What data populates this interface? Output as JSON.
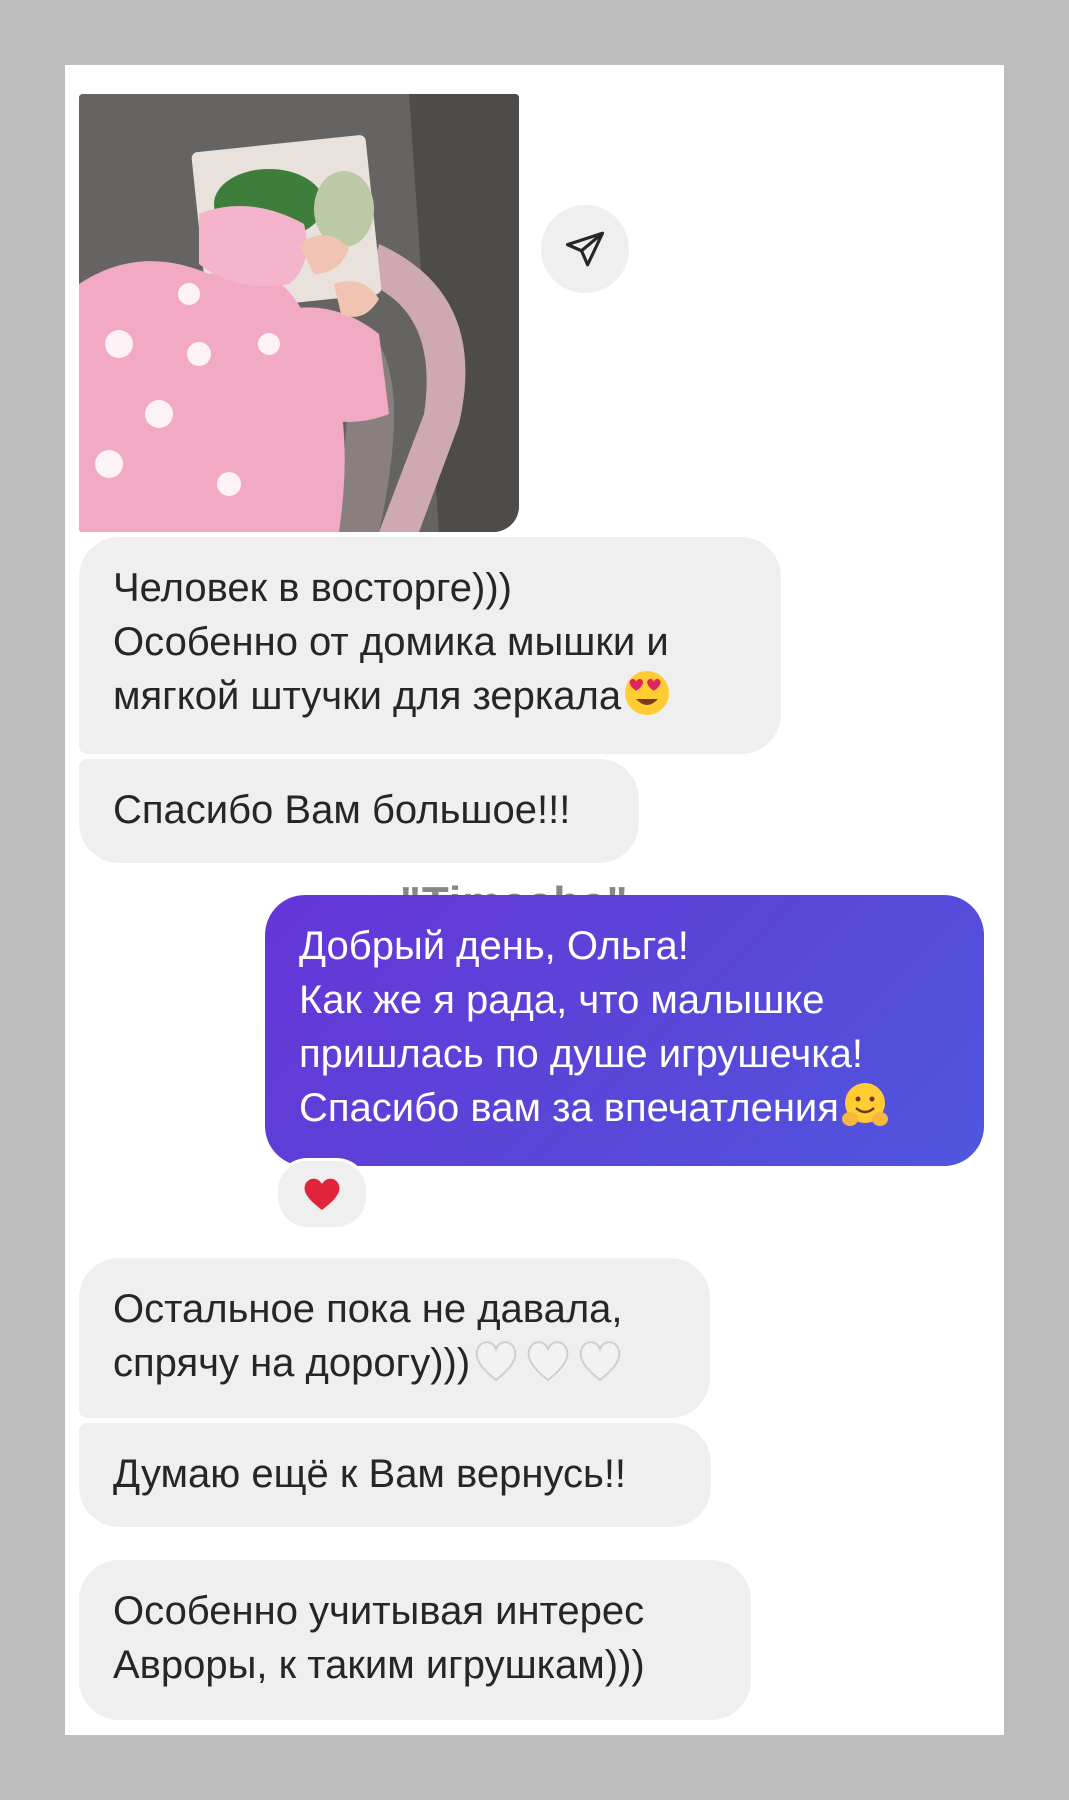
{
  "watermark": "\"Timasha\"",
  "photo": {
    "description_icon": "photo-attachment"
  },
  "share": {
    "icon": "paper-plane-icon"
  },
  "messages": [
    {
      "direction": "incoming",
      "lines": [
        "Человек в восторге)))",
        "Особенно от домика мышки и",
        "мягкой штучки для зеркала"
      ],
      "trailing_emoji": "😍"
    },
    {
      "direction": "incoming",
      "lines": [
        "Спасибо Вам большое!!!"
      ]
    },
    {
      "direction": "outgoing",
      "lines": [
        "Добрый день, Ольга!",
        "Как же я рада, что малышке",
        "пришлась по душе игрушечка!",
        "Спасибо вам за впечатления"
      ],
      "trailing_emoji": "🤗",
      "reaction": "❤️"
    },
    {
      "direction": "incoming",
      "lines": [
        "Остальное пока не давала,",
        "спрячу на дорогу)))"
      ],
      "trailing_emoji": "🤍🤍🤍"
    },
    {
      "direction": "incoming",
      "lines": [
        "Думаю ещё к Вам вернусь!!"
      ]
    },
    {
      "direction": "incoming",
      "lines": [
        "Особенно учитывая интерес",
        "Авроры, к таким игрушкам)))"
      ]
    }
  ],
  "colors": {
    "incoming_bubble": "#efefef",
    "outgoing_start": "#6535d8",
    "outgoing_end": "#4f56df",
    "frame_border": "#bdbdbd"
  }
}
